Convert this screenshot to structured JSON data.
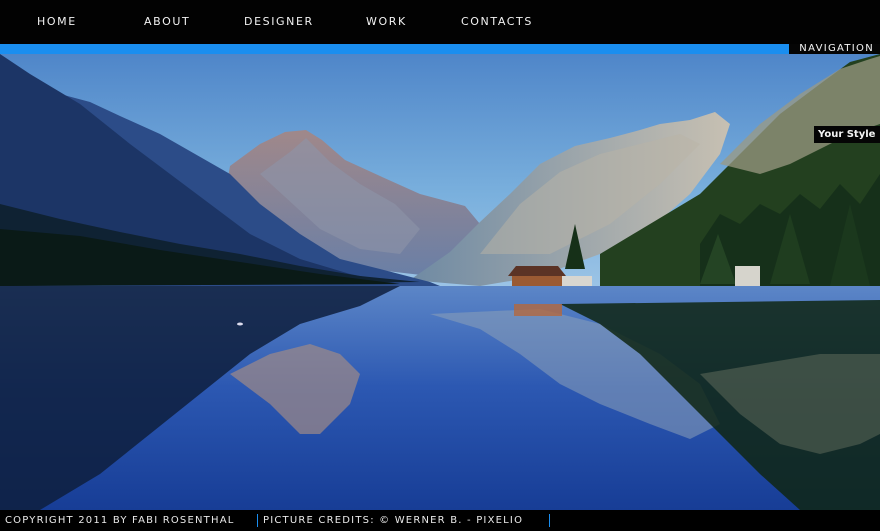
{
  "nav": {
    "items": [
      "HOME",
      "ABOUT",
      "DESIGNER",
      "WORK",
      "CONTACTS"
    ],
    "panel_label": "NAVIGATION"
  },
  "hero": {
    "style_tag": "Your Style"
  },
  "footer": {
    "copyright": "COPYRIGHT 2011 BY FABI ROSENTHAL",
    "credits": "PICTURE CREDITS: © WERNER B. - PIXELIO"
  },
  "colors": {
    "accent": "#1a8ef0",
    "bar": "#020202"
  }
}
